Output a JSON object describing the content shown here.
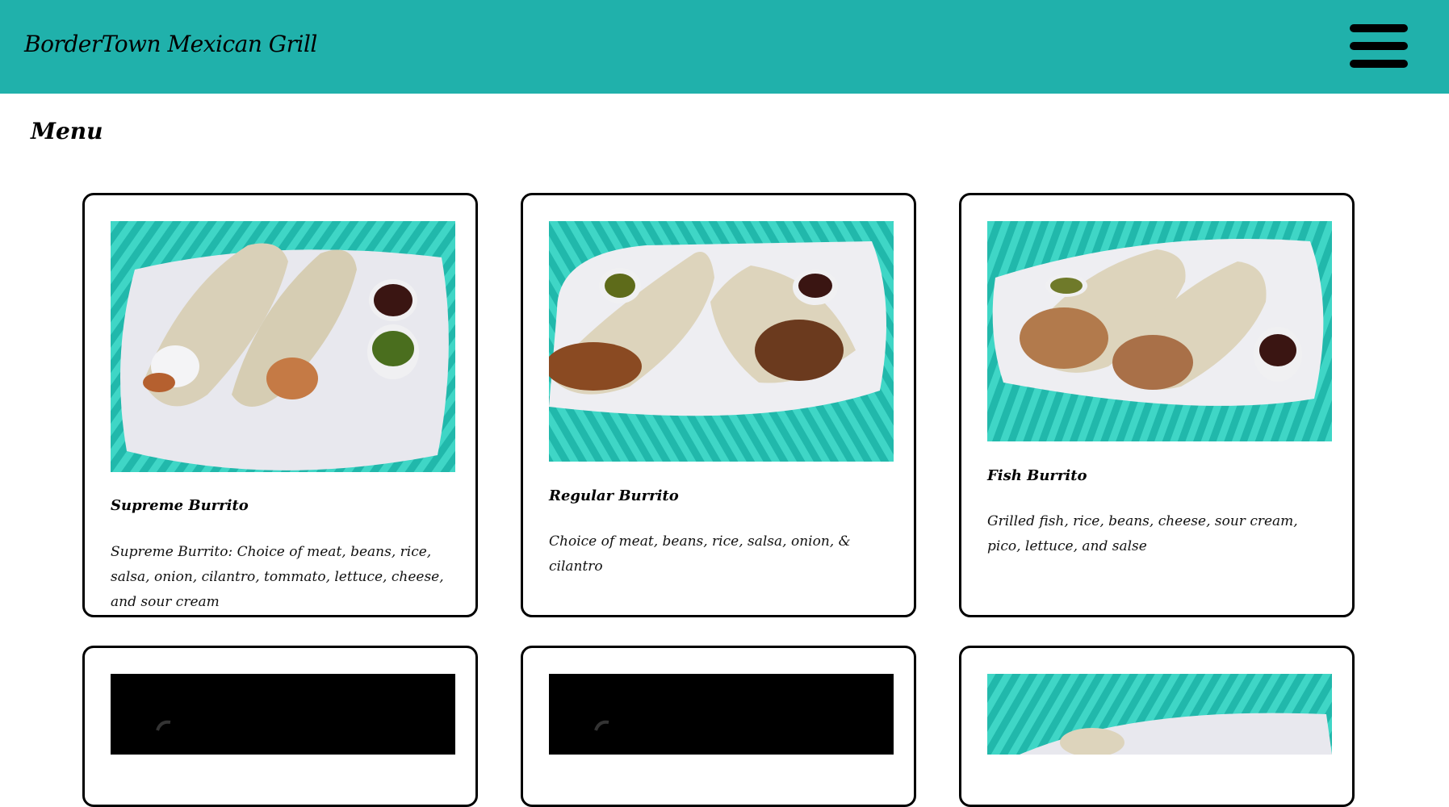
{
  "header": {
    "site_title": "BorderTown Mexican Grill",
    "menu_icon": "hamburger-menu-icon"
  },
  "page": {
    "title": "Menu"
  },
  "menu_items": [
    {
      "name": "Supreme Burrito",
      "description": "Supreme Burrito: Choice of meat, beans, rice, salsa, onion, cilantro, tommato, lettuce, cheese, and sour cream"
    },
    {
      "name": "Regular Burrito",
      "description": "Choice of meat, beans, rice, salsa, onion, & cilantro"
    },
    {
      "name": "Fish Burrito",
      "description": "Grilled fish, rice, beans, cheese, sour cream, pico, lettuce, and salse"
    },
    {
      "name": "",
      "description": ""
    },
    {
      "name": "",
      "description": ""
    },
    {
      "name": "",
      "description": ""
    }
  ],
  "colors": {
    "header_bg": "#20b1ab",
    "card_border": "#000000",
    "photo_bg": "#23c1b5"
  }
}
